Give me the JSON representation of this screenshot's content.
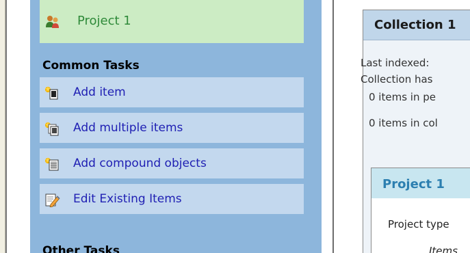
{
  "sidebar": {
    "project": {
      "label": "Project 1",
      "icon": "users-icon"
    },
    "common_tasks": {
      "header": "Common Tasks",
      "items": [
        {
          "label": "Add item",
          "icon": "add-item-icon"
        },
        {
          "label": "Add multiple items",
          "icon": "add-multiple-items-icon"
        },
        {
          "label": "Add compound objects",
          "icon": "add-compound-objects-icon"
        },
        {
          "label": "Edit Existing Items",
          "icon": "edit-items-icon"
        }
      ]
    },
    "other_tasks": {
      "header": "Other Tasks"
    }
  },
  "main": {
    "collection_panel": {
      "title": "Collection 1",
      "last_indexed": "Last indexed:",
      "collection_has": "Collection has",
      "items_in_pending": "0 items in pe",
      "items_in_collection": "0 items in col"
    },
    "project_panel": {
      "title": "Project 1",
      "project_type": "Project type",
      "items": "Items"
    }
  },
  "colors": {
    "sidebar_bg": "#8db6dc",
    "project_bg": "#ccecc4",
    "project_text": "#2f8a3a",
    "task_bg": "#c3d8ee",
    "task_link": "#1f1fb3",
    "project_panel_title": "#2c7fb0"
  }
}
